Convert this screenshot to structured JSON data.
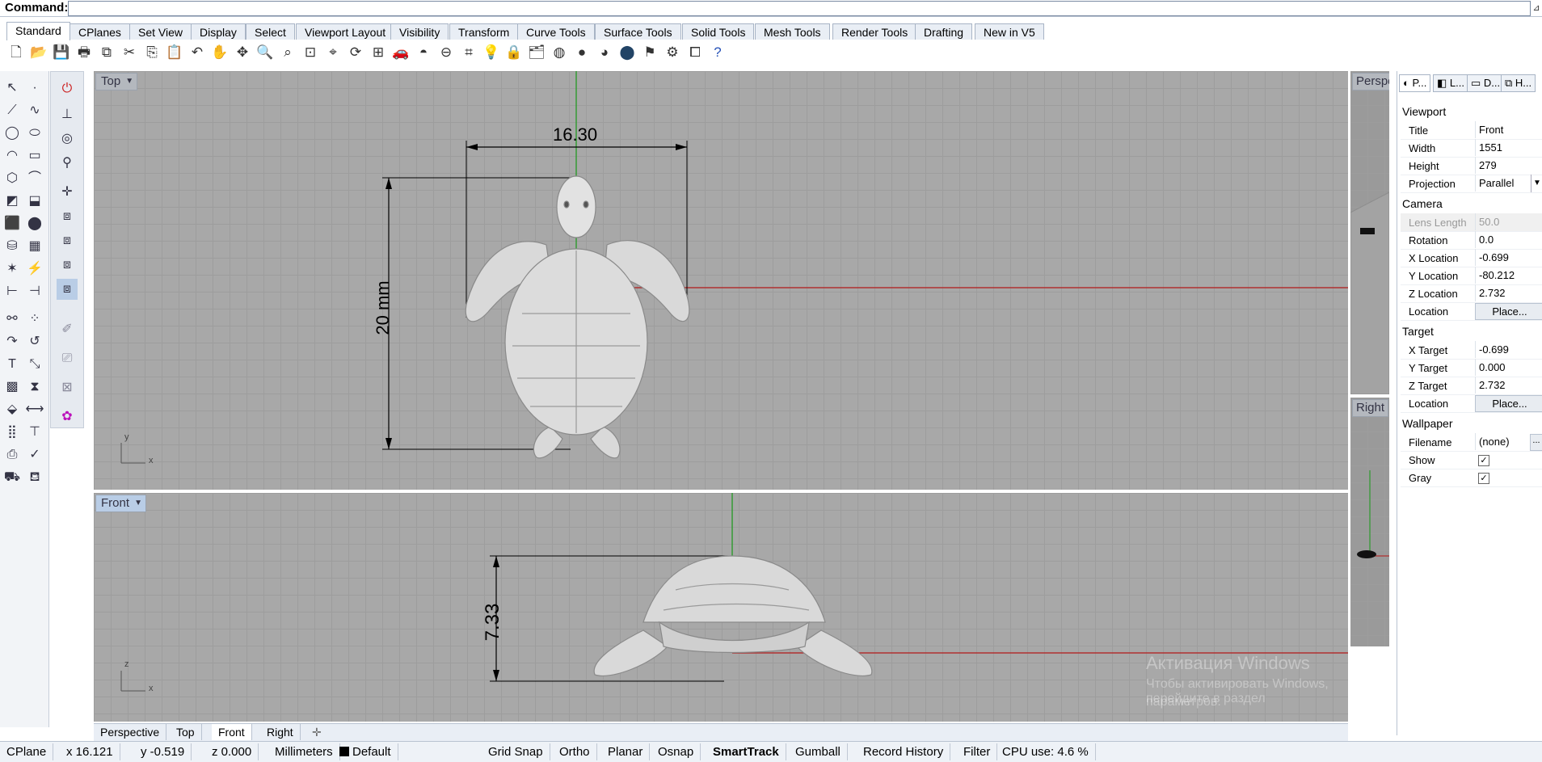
{
  "command": {
    "label": "Command:",
    "value": ""
  },
  "tabs": [
    "Standard",
    "CPlanes",
    "Set View",
    "Display",
    "Select",
    "Viewport Layout",
    "Visibility",
    "Transform",
    "Curve Tools",
    "Surface Tools",
    "Solid Tools",
    "Mesh Tools",
    "Render Tools",
    "Drafting",
    "New in V5"
  ],
  "active_tab": "Standard",
  "toolbar_icons": [
    "new-icon",
    "open-icon",
    "save-icon",
    "print-icon",
    "import-icon",
    "cut-icon",
    "copy-icon",
    "paste-icon",
    "undo-icon",
    "pan-icon",
    "move-view-icon",
    "zoom-icon",
    "zoom-window-icon",
    "zoom-extents-icon",
    "zoom-selected-icon",
    "rotate-view-icon",
    "four-views-icon",
    "car-icon",
    "shade-icon",
    "circle-icon",
    "grid-icon",
    "light-icon",
    "lock-icon",
    "layer-icon",
    "color-wheel-icon",
    "sphere-icon",
    "render-icon",
    "material-icon",
    "flag-icon",
    "gear-icon",
    "bbox-icon",
    "help-icon"
  ],
  "viewports": {
    "top": {
      "title": "Top",
      "dim_width": "16.30",
      "dim_height": "20 mm",
      "axis_y": "y",
      "axis_x": "x"
    },
    "front": {
      "title": "Front",
      "dim_height": "7.33",
      "axis_z": "z",
      "axis_x": "x"
    },
    "perspective": {
      "title": "Perspe"
    },
    "right": {
      "title": "Right"
    }
  },
  "properties": {
    "tabs": [
      "P...",
      "L...",
      "D...",
      "H..."
    ],
    "viewport_header": "Viewport",
    "title_label": "Title",
    "title_value": "Front",
    "width_label": "Width",
    "width_value": "1551",
    "height_label": "Height",
    "height_value": "279",
    "projection_label": "Projection",
    "projection_value": "Parallel",
    "camera_header": "Camera",
    "lens_label": "Lens Length",
    "lens_value": "50.0",
    "rotation_label": "Rotation",
    "rotation_value": "0.0",
    "xloc_label": "X Location",
    "xloc_value": "-0.699",
    "yloc_label": "Y Location",
    "yloc_value": "-80.212",
    "zloc_label": "Z Location",
    "zloc_value": "2.732",
    "location_label": "Location",
    "place_label": "Place...",
    "target_header": "Target",
    "xt_label": "X Target",
    "xt_value": "-0.699",
    "yt_label": "Y Target",
    "yt_value": "0.000",
    "zt_label": "Z Target",
    "zt_value": "2.732",
    "tloc_label": "Location",
    "tplace_label": "Place...",
    "wallpaper_header": "Wallpaper",
    "filename_label": "Filename",
    "filename_value": "(none)",
    "filename_more": "...",
    "show_label": "Show",
    "show_checked": "✓",
    "gray_label": "Gray",
    "gray_checked": "✓"
  },
  "viewport_tabs": [
    "Perspective",
    "Top",
    "Front",
    "Right"
  ],
  "active_viewport_tab": "Front",
  "status": {
    "cplane": "CPlane",
    "x": "x 16.121",
    "y": "y -0.519",
    "z": "z 0.000",
    "units": "Millimeters",
    "layer": "Default",
    "grid_snap": "Grid Snap",
    "ortho": "Ortho",
    "planar": "Planar",
    "osnap": "Osnap",
    "smarttrack": "SmartTrack",
    "gumball": "Gumball",
    "record_history": "Record History",
    "filter": "Filter",
    "cpu": "CPU use: 4.6 %"
  },
  "watermark": {
    "line1": "Активация Windows",
    "line2": "Чтобы активировать Windows, перейдите в раздел",
    "line3": "параметров."
  },
  "colors": {
    "x_axis": "#b03030",
    "y_axis": "#2e9a2e",
    "grid_bg": "#a8a8a8",
    "model": "#d9d9d9"
  }
}
